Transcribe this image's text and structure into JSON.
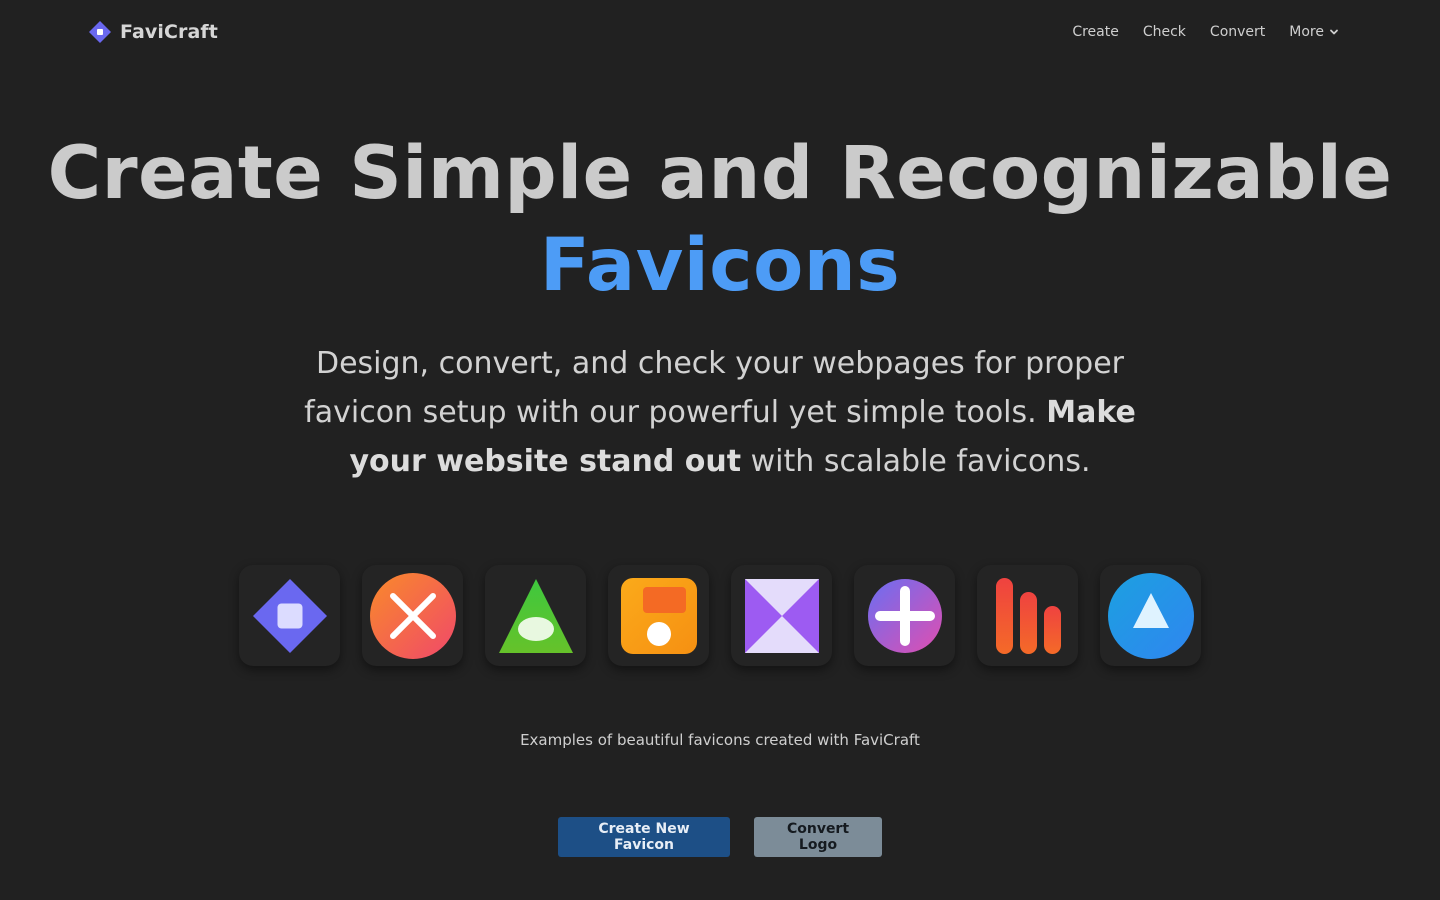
{
  "brand": {
    "name": "FaviCraft",
    "logo_icon": "diamond-logo-icon",
    "color": "#6a68f0"
  },
  "nav": {
    "links": [
      {
        "label": "Create"
      },
      {
        "label": "Check"
      },
      {
        "label": "Convert"
      },
      {
        "label": "More",
        "icon": "chevron-down-icon"
      }
    ]
  },
  "hero": {
    "title_line1": "Create Simple and Recognizable",
    "title_line2": "Favicons",
    "accent_color": "#4d9cf6",
    "subtitle_part1": "Design, convert, and check your webpages for proper favicon setup with our powerful yet simple tools. ",
    "subtitle_bold": "Make your website stand out",
    "subtitle_part2": " with scalable favicons."
  },
  "examples": {
    "icons": [
      {
        "icon": "diamond-square-icon"
      },
      {
        "icon": "cross-circle-icon"
      },
      {
        "icon": "triangle-eye-icon"
      },
      {
        "icon": "orange-square-dot-icon"
      },
      {
        "icon": "hourglass-icon"
      },
      {
        "icon": "plus-circle-icon"
      },
      {
        "icon": "bar-chart-icon"
      },
      {
        "icon": "triangle-circle-icon"
      }
    ],
    "caption": "Examples of beautiful favicons created with FaviCraft"
  },
  "actions": {
    "primary_label": "Create New Favicon",
    "secondary_label": "Convert Logo",
    "primary_color": "#1d4f86",
    "secondary_color": "#7c8c98"
  }
}
